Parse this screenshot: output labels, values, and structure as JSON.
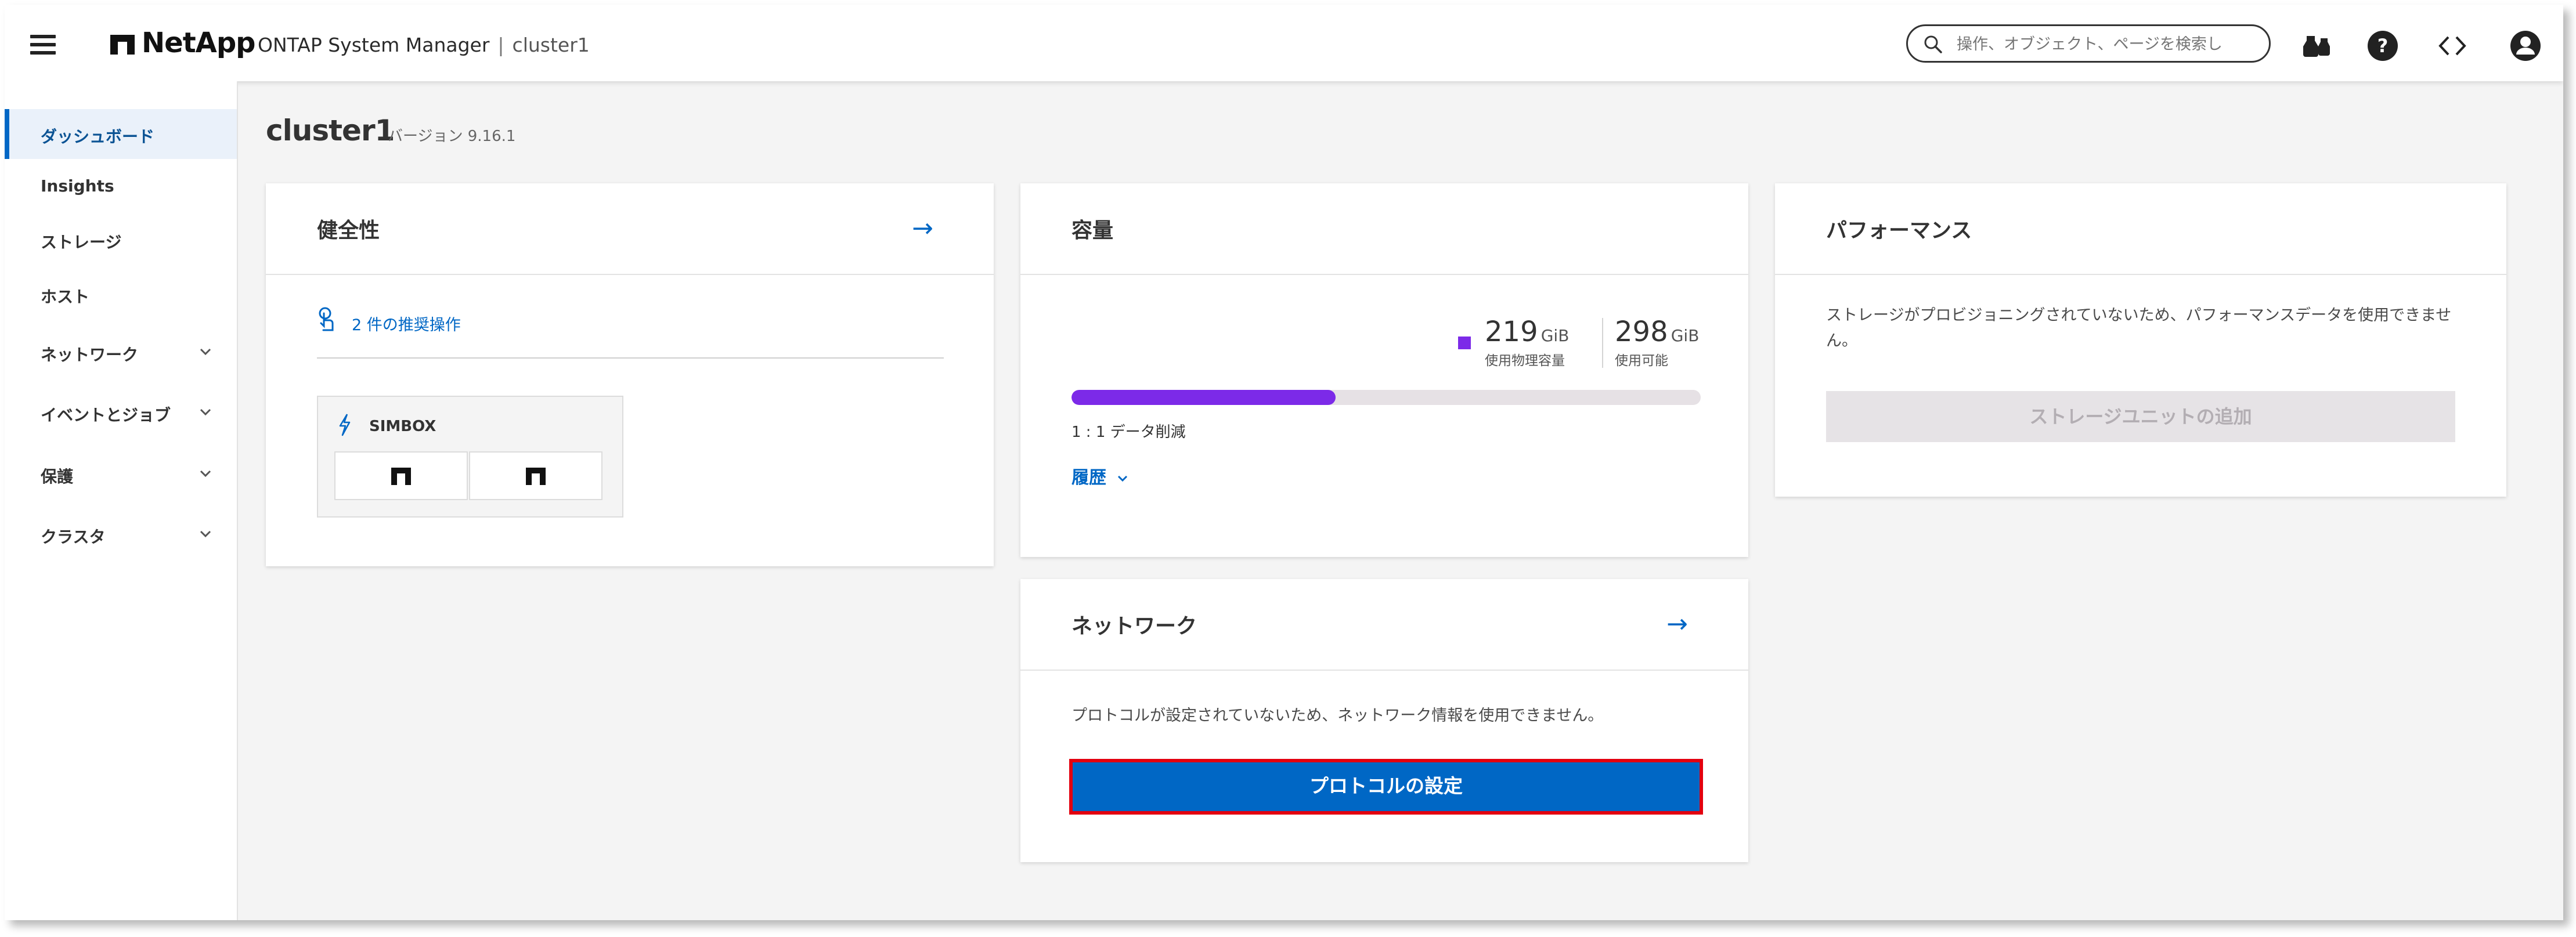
{
  "header": {
    "brand": "NetApp",
    "app_name": "ONTAP System Manager",
    "cluster_name": "cluster1",
    "search_placeholder": "操作、オブジェクト、ページを検索し"
  },
  "sidebar": {
    "items": [
      {
        "label": "ダッシュボード",
        "active": true,
        "expandable": false
      },
      {
        "label": "Insights",
        "active": false,
        "expandable": false
      },
      {
        "label": "ストレージ",
        "active": false,
        "expandable": false
      },
      {
        "label": "ホスト",
        "active": false,
        "expandable": false
      },
      {
        "label": "ネットワーク",
        "active": false,
        "expandable": true
      },
      {
        "label": "イベントとジョブ",
        "active": false,
        "expandable": true
      },
      {
        "label": "保護",
        "active": false,
        "expandable": true
      },
      {
        "label": "クラスタ",
        "active": false,
        "expandable": true
      }
    ]
  },
  "page": {
    "title": "cluster1",
    "version": "バージョン 9.16.1"
  },
  "health": {
    "title": "健全性",
    "recommendations": "2 件の推奨操作",
    "node_label": "SIMBOX"
  },
  "capacity": {
    "title": "容量",
    "used_value": "219",
    "used_unit": "GiB",
    "used_label": "使用物理容量",
    "available_value": "298",
    "available_unit": "GiB",
    "available_label": "使用可能",
    "used_fraction": 0.42,
    "reduction": "1 : 1 データ削減",
    "history": "履歴"
  },
  "performance": {
    "title": "パフォーマンス",
    "message": "ストレージがプロビジョニングされていないため、パフォーマンスデータを使用できません。",
    "button": "ストレージユニットの追加"
  },
  "network": {
    "title": "ネットワーク",
    "message": "プロトコルが設定されていないため、ネットワーク情報を使用できません。",
    "button": "プロトコルの設定"
  },
  "colors": {
    "accent": "#0067c5",
    "capacity_bar": "#7c2ae8",
    "highlight_border": "#e3000f"
  }
}
